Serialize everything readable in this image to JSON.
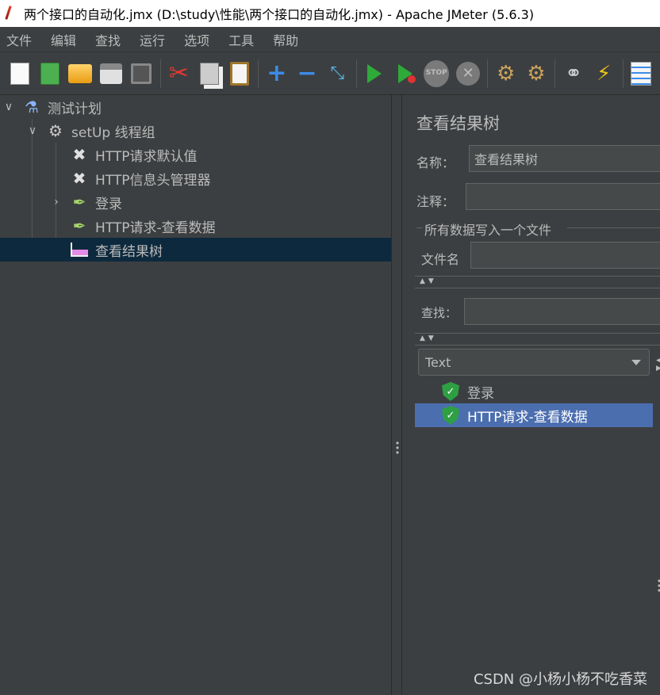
{
  "window": {
    "title": "两个接口的自动化.jmx (D:\\study\\性能\\两个接口的自动化.jmx) - Apache JMeter (5.6.3)"
  },
  "menu": [
    "文件",
    "编辑",
    "查找",
    "运行",
    "选项",
    "工具",
    "帮助"
  ],
  "toolbar": {
    "stop_label": "STOP"
  },
  "tree": {
    "items": [
      {
        "label": "测试计划",
        "icon": "flask-icon",
        "expanded": true
      },
      {
        "label": "setUp 线程组",
        "icon": "gear-icon",
        "expanded": true
      },
      {
        "label": "HTTP请求默认值",
        "icon": "tools-icon"
      },
      {
        "label": "HTTP信息头管理器",
        "icon": "tools-icon"
      },
      {
        "label": "登录",
        "icon": "dropper-icon",
        "expanded": false
      },
      {
        "label": "HTTP请求-查看数据",
        "icon": "dropper-icon"
      },
      {
        "label": "查看结果树",
        "icon": "graph-icon",
        "selected": true
      }
    ]
  },
  "panel": {
    "title": "查看结果树",
    "name_label": "名称：",
    "name_value": "查看结果树",
    "comment_label": "注释：",
    "comment_value": "",
    "file_group_label": "所有数据写入一个文件",
    "filename_label": "文件名",
    "filename_value": "",
    "search_label": "查找：",
    "search_value": "",
    "renderer_selected": "Text",
    "results": [
      {
        "label": "登录",
        "status": "success"
      },
      {
        "label": "HTTP请求-查看数据",
        "status": "success",
        "selected": true
      }
    ]
  },
  "watermark": "CSDN @小杨小杨不吃香菜"
}
